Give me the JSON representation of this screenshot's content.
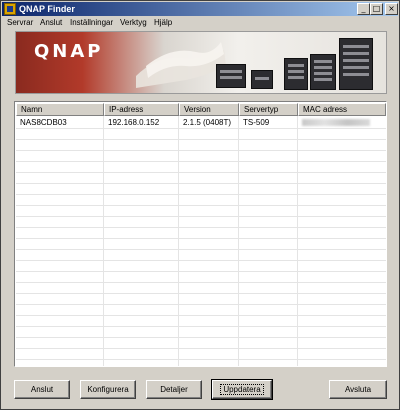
{
  "window": {
    "title": "QNAP Finder"
  },
  "menu": [
    "Servrar",
    "Anslut",
    "Inställningar",
    "Verktyg",
    "Hjälp"
  ],
  "banner": {
    "logo": "QNAP"
  },
  "table": {
    "columns": [
      "Namn",
      "IP-adress",
      "Version",
      "Servertyp",
      "MAC adress"
    ],
    "rows": [
      {
        "name": "NAS8CDB03",
        "ip": "192.168.0.152",
        "version": "2.1.5 (0408T)",
        "type": "TS-509",
        "mac": ""
      }
    ]
  },
  "buttons": {
    "connect": "Anslut",
    "configure": "Konfigurera",
    "details": "Detaljer",
    "refresh": "Uppdatera",
    "exit": "Avsluta"
  },
  "colors": {
    "titlebar": "#0a246a",
    "face": "#d4d0c8"
  },
  "icons": {
    "app": "qnap-app-icon",
    "minimize": "minimize-icon",
    "maximize": "maximize-icon",
    "close": "close-icon"
  }
}
